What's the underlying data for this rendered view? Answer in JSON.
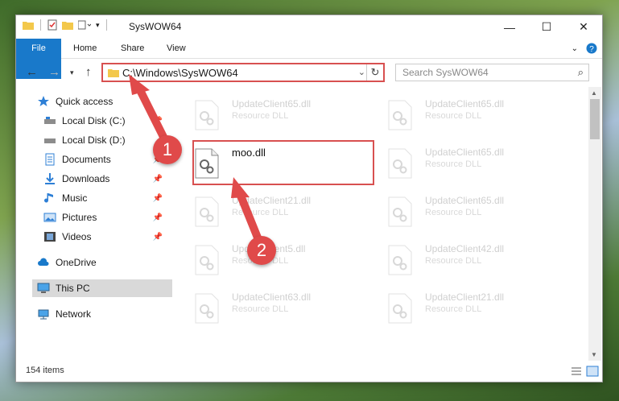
{
  "window": {
    "title": "SysWOW64",
    "controls": {
      "minimize": "—",
      "maximize": "☐",
      "close": "✕"
    }
  },
  "ribbon": {
    "tabs": [
      "File",
      "Home",
      "Share",
      "View"
    ]
  },
  "navigation": {
    "address_path": "C:\\Windows\\SysWOW64",
    "search_placeholder": "Search SysWOW64"
  },
  "sidebar": {
    "items": [
      {
        "label": "Quick access",
        "icon": "star-icon",
        "pinned": false
      },
      {
        "label": "Local Disk (C:)",
        "icon": "drive-icon",
        "pinned": true
      },
      {
        "label": "Local Disk (D:)",
        "icon": "drive-icon",
        "pinned": false
      },
      {
        "label": "Documents",
        "icon": "documents-icon",
        "pinned": true
      },
      {
        "label": "Downloads",
        "icon": "download-icon",
        "pinned": true
      },
      {
        "label": "Music",
        "icon": "music-icon",
        "pinned": true
      },
      {
        "label": "Pictures",
        "icon": "pictures-icon",
        "pinned": true
      },
      {
        "label": "Videos",
        "icon": "videos-icon",
        "pinned": true
      },
      {
        "label": "OneDrive",
        "icon": "cloud-icon",
        "pinned": false
      },
      {
        "label": "This PC",
        "icon": "computer-icon",
        "pinned": false,
        "selected": true
      },
      {
        "label": "Network",
        "icon": "network-icon",
        "pinned": false
      }
    ]
  },
  "files": {
    "highlighted": {
      "name": "moo.dll",
      "type": ""
    },
    "faded": [
      {
        "name": "UpdateClient65.dll",
        "type": "Resource DLL"
      },
      {
        "name": "UpdateClient65.dll",
        "type": "Resource DLL"
      },
      {
        "name": "UpdateClient65.dll",
        "type": "Resource DLL"
      },
      {
        "name": "UpdateClient21.dll",
        "type": "Resource DLL"
      },
      {
        "name": "UpdateClient65.dll",
        "type": "Resource DLL"
      },
      {
        "name": "UpdateClient5.dll",
        "type": "Resource DLL"
      },
      {
        "name": "UpdateClient42.dll",
        "type": "Resource DLL"
      },
      {
        "name": "UpdateClient63.dll",
        "type": "Resource DLL"
      },
      {
        "name": "UpdateClient21.dll",
        "type": "Resource DLL"
      }
    ]
  },
  "status": {
    "item_count": "154 items"
  },
  "annotations": {
    "step1": "1",
    "step2": "2"
  },
  "colors": {
    "accent": "#1979ca",
    "highlight": "#d85050",
    "badge": "#e04a4a"
  }
}
